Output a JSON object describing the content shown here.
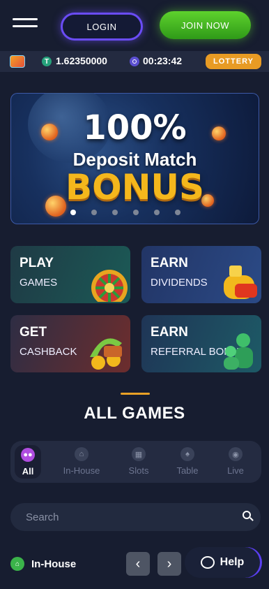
{
  "header": {
    "login_label": "LOGIN",
    "join_label": "JOIN NOW"
  },
  "status": {
    "balance": "1.62350000",
    "timer": "00:23:42",
    "lottery_label": "LOTTERY",
    "token_symbol": "T"
  },
  "banner": {
    "line1": "100%",
    "line2": "Deposit Match",
    "line3": "BONUS",
    "slide_count": 6,
    "active_slide": 0
  },
  "cards": [
    {
      "title": "PLAY",
      "subtitle": "GAMES"
    },
    {
      "title": "EARN",
      "subtitle": "DIVIDENDS"
    },
    {
      "title": "GET",
      "subtitle": "CASHBACK"
    },
    {
      "title": "EARN",
      "subtitle": "REFERRAL BONUS"
    }
  ],
  "section": {
    "heading": "ALL GAMES"
  },
  "tabs": [
    {
      "label": "All",
      "icon": "gamepad-icon",
      "active": true
    },
    {
      "label": "In-House",
      "icon": "home-icon"
    },
    {
      "label": "Slots",
      "icon": "slots-icon"
    },
    {
      "label": "Table",
      "icon": "cards-icon"
    },
    {
      "label": "Live",
      "icon": "live-icon"
    }
  ],
  "search": {
    "placeholder": "Search"
  },
  "footer": {
    "category_label": "In-House",
    "help_label": "Help"
  },
  "colors": {
    "background": "#171d30",
    "login_border": "#6a4cf5",
    "join": "#4cba25",
    "lottery": "#e89b24",
    "active_tab_icon": "#b04de0"
  }
}
